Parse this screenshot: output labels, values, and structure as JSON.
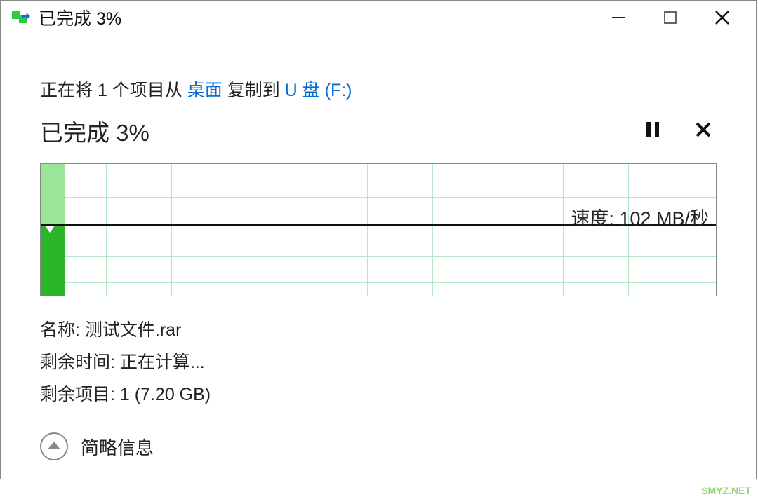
{
  "window": {
    "title": "已完成 3%"
  },
  "copy": {
    "prefix": "正在将 1 个项目从 ",
    "source": "桌面",
    "mid": " 复制到 ",
    "dest": "U 盘 (F:)"
  },
  "progress": {
    "label": "已完成 3%",
    "percent": 3
  },
  "speed": {
    "label": "速度: 102 MB/秒",
    "value": 102,
    "unit": "MB/秒"
  },
  "details": {
    "name_label": "名称:",
    "name_value": "测试文件.rar",
    "time_label": "剩余时间:",
    "time_value": "正在计算...",
    "items_label": "剩余项目:",
    "items_value": "1 (7.20 GB)"
  },
  "footer": {
    "toggle_label": "简略信息"
  },
  "watermark": "SMYZ.NET",
  "colors": {
    "link": "#0a6bd1",
    "bar_light": "#9be59b",
    "bar_dark": "#2bb52b",
    "grid": "#b8e6c8"
  }
}
